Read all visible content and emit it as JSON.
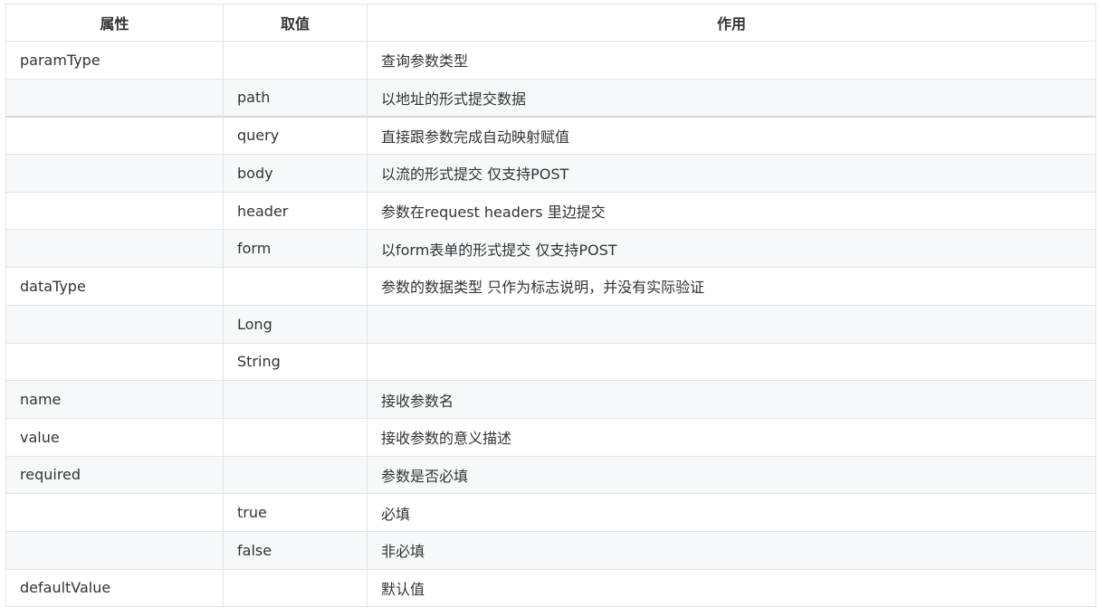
{
  "table": {
    "headers": [
      "属性",
      "取值",
      "作用"
    ],
    "rows": [
      [
        "paramType",
        "",
        "查询参数类型"
      ],
      [
        "",
        "path",
        "以地址的形式提交数据"
      ],
      [
        "",
        "query",
        "直接跟参数完成自动映射赋值"
      ],
      [
        "",
        "body",
        "以流的形式提交 仅支持POST"
      ],
      [
        "",
        "header",
        "参数在request headers 里边提交"
      ],
      [
        "",
        "form",
        "以form表单的形式提交 仅支持POST"
      ],
      [
        "dataType",
        "",
        "参数的数据类型 只作为标志说明，并没有实际验证"
      ],
      [
        "",
        "Long",
        ""
      ],
      [
        "",
        "String",
        ""
      ],
      [
        "name",
        "",
        "接收参数名"
      ],
      [
        "value",
        "",
        "接收参数的意义描述"
      ],
      [
        "required",
        "",
        "参数是否必填"
      ],
      [
        "",
        "true",
        "必填"
      ],
      [
        "",
        "false",
        "非必填"
      ],
      [
        "defaultValue",
        "",
        "默认值"
      ]
    ]
  }
}
